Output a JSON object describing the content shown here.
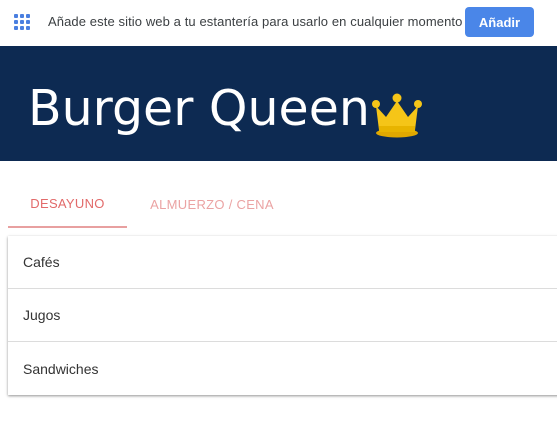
{
  "shelf_bar": {
    "icon": "apps-grid-icon",
    "message": "Añade este sitio web a tu estantería para usarlo en cualquier momento",
    "add_label": "Añadir"
  },
  "header": {
    "title": "Burger Queen",
    "icon": "crown-icon"
  },
  "tabs": [
    {
      "label": "DESAYUNO",
      "active": true
    },
    {
      "label": "ALMUERZO / CENA",
      "active": false
    }
  ],
  "menu": {
    "items": [
      {
        "label": "Cafés"
      },
      {
        "label": "Jugos"
      },
      {
        "label": "Sandwiches"
      }
    ]
  },
  "colors": {
    "header_bg": "#0d2a52",
    "button_bg": "#4a86e8",
    "active_tab": "#e26a6a",
    "crown": "#f5c518"
  }
}
